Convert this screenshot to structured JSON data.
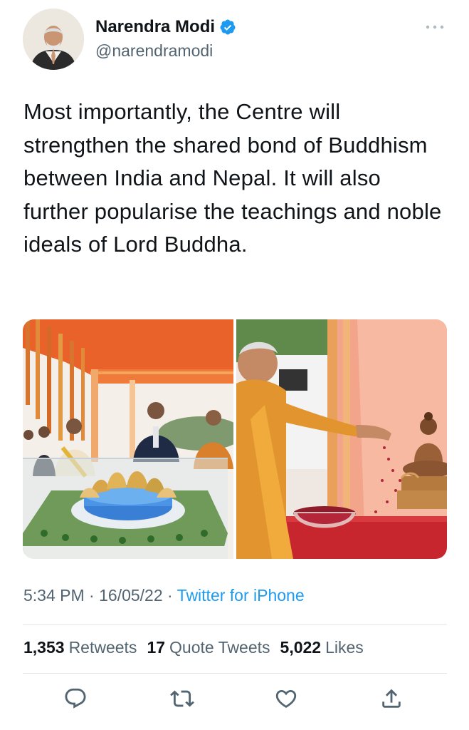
{
  "user": {
    "display_name": "Narendra Modi",
    "handle": "@narendramodi",
    "verified": true
  },
  "tweet": {
    "text": "Most importantly, the Centre will strengthen the shared bond of Buddhism between India and Nepal. It will also further popularise the teachings and noble ideals of Lord Buddha.",
    "time": "5:34 PM",
    "date": "16/05/22",
    "source": "Twitter for iPhone",
    "separator": " · "
  },
  "stats": {
    "retweets_count": "1,353",
    "retweets_label": "Retweets",
    "quotes_count": "17",
    "quotes_label": "Quote Tweets",
    "likes_count": "5,022",
    "likes_label": "Likes"
  },
  "actions": [
    {
      "icon": "reply-icon"
    },
    {
      "icon": "retweet-icon"
    },
    {
      "icon": "like-icon"
    },
    {
      "icon": "share-icon"
    }
  ],
  "colors": {
    "accent": "#1d9bf0",
    "secondary_text": "#536471",
    "primary_text": "#0f1419",
    "divider": "#e1e6ea"
  }
}
